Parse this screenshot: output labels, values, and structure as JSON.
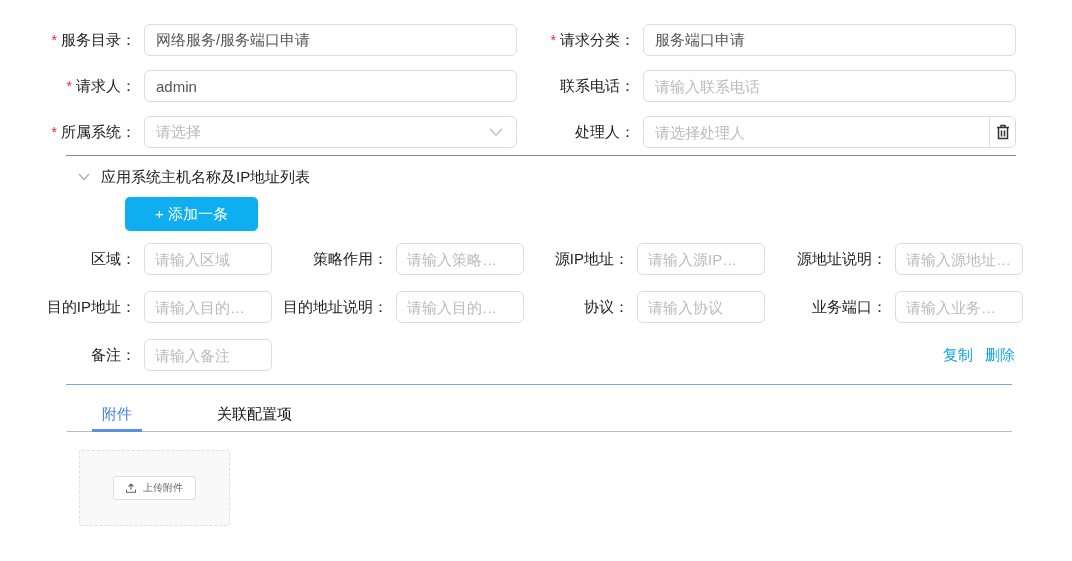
{
  "form": {
    "fields": [
      {
        "label": "服务目录：",
        "required_mark": "*",
        "kind": "input",
        "value": "网络服务/服务端口申请"
      },
      {
        "label": "请求分类：",
        "required_mark": "*",
        "kind": "input",
        "value": "服务端口申请"
      },
      {
        "label": "请求人：",
        "required_mark": "*",
        "kind": "input",
        "value": "admin"
      },
      {
        "label": "联系电话：",
        "kind": "input",
        "placeholder": "请输入联系电话"
      },
      {
        "label": "所属系统：",
        "required_mark": "*",
        "kind": "select",
        "placeholder": "请选择"
      },
      {
        "label": "处理人：",
        "kind": "picker",
        "placeholder": "请选择处理人"
      }
    ]
  },
  "section": {
    "title": "应用系统主机名称及IP地址列表",
    "expanded": true,
    "add_button": "+ 添加一条",
    "fields": [
      {
        "label": "区域：",
        "placeholder": "请输入区域"
      },
      {
        "label": "策略作用：",
        "placeholder": "请输入策略…"
      },
      {
        "label": "源IP地址：",
        "placeholder": "请输入源IP…"
      },
      {
        "label": "源地址说明：",
        "placeholder": "请输入源地址…"
      },
      {
        "label": "目的IP地址：",
        "placeholder": "请输入目的…"
      },
      {
        "label": "目的地址说明：",
        "placeholder": "请输入目的…"
      },
      {
        "label": "协议：",
        "placeholder": "请输入协议"
      },
      {
        "label": "业务端口：",
        "placeholder": "请输入业务…"
      },
      {
        "label": "备注：",
        "placeholder": "请输入备注"
      }
    ],
    "actions": [
      "复制",
      "删除"
    ]
  },
  "tabs": [
    {
      "label": "附件",
      "selected": true
    },
    {
      "label": "关联配置项",
      "selected": false
    }
  ],
  "upload": {
    "button": "上传附件"
  }
}
